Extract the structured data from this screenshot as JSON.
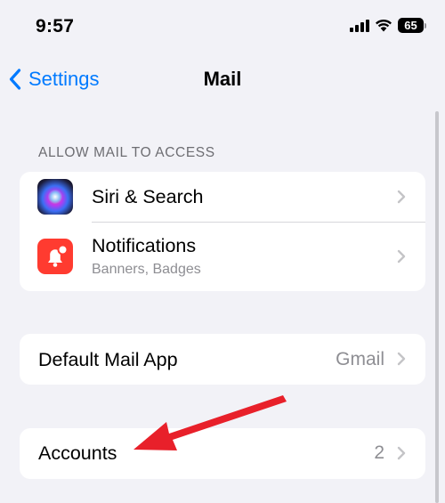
{
  "status_bar": {
    "time": "9:57",
    "battery_level": "65",
    "icons": [
      "signal-icon",
      "wifi-icon",
      "battery-icon"
    ]
  },
  "nav": {
    "back_label": "Settings",
    "title": "Mail"
  },
  "sections": {
    "allow_access": {
      "header": "ALLOW MAIL TO ACCESS",
      "rows": [
        {
          "title": "Siri & Search",
          "icon": "siri-icon"
        },
        {
          "title": "Notifications",
          "subtitle": "Banners, Badges",
          "icon": "notifications-icon"
        }
      ]
    },
    "default_app": {
      "title": "Default Mail App",
      "value": "Gmail"
    },
    "accounts": {
      "title": "Accounts",
      "value": "2"
    }
  },
  "colors": {
    "accent": "#007aff",
    "background": "#f2f2f7",
    "secondary_text": "#8e8e93",
    "notifications_icon": "#ff3b30",
    "annotation_arrow": "#e8202a"
  }
}
